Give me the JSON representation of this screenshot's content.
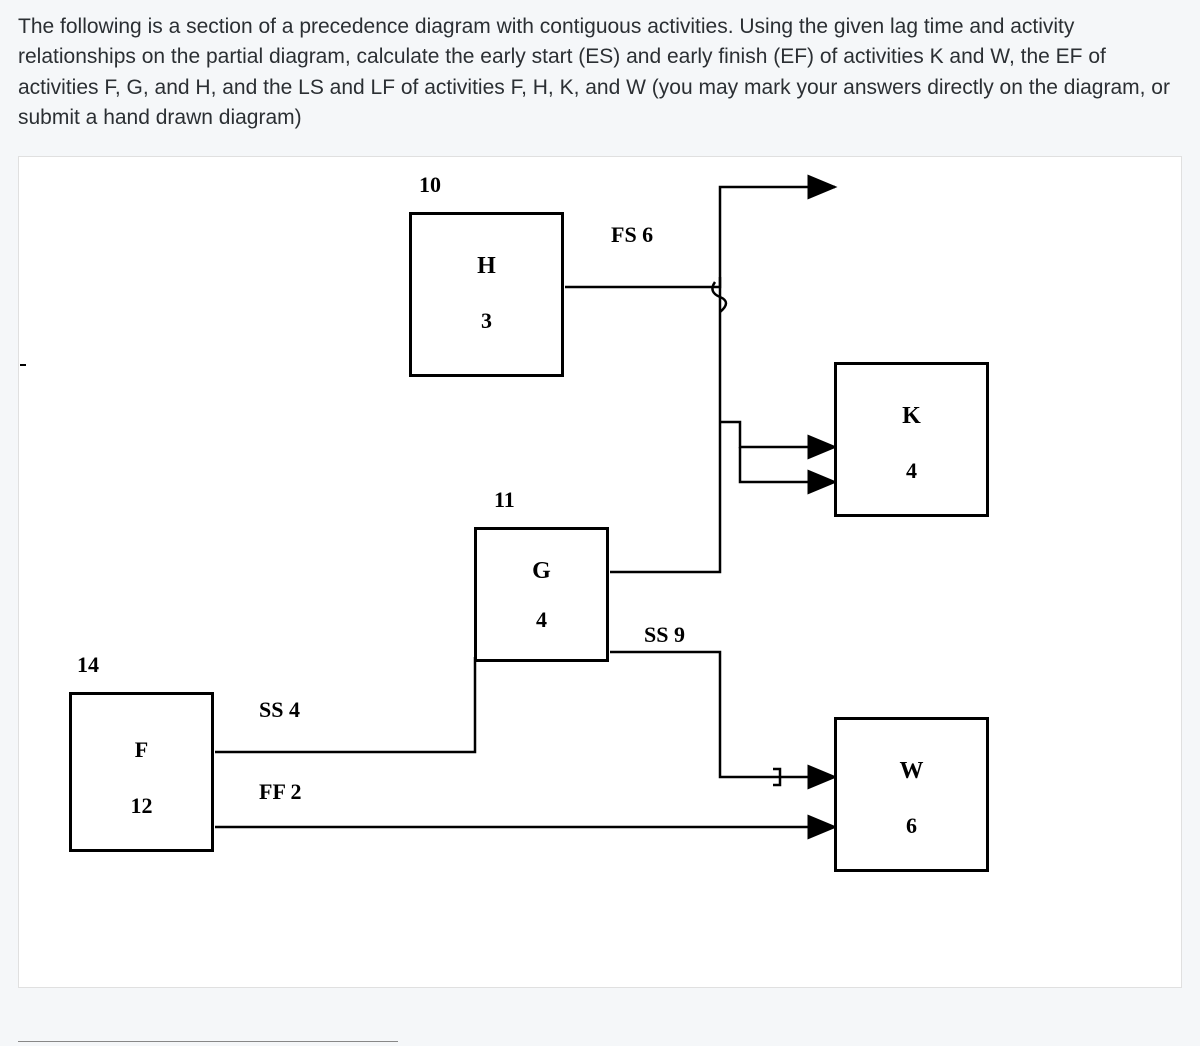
{
  "question": "The following is a section of a precedence diagram with contiguous activities.  Using the given lag time and activity relationships on the partial diagram, calculate the early start (ES) and early finish (EF) of activities K and W, the EF of activities F, G, and H, and the LS and LF of activities F, H, K, and W (you may mark your answers directly on the diagram, or submit a hand drawn diagram)",
  "activities": {
    "H": {
      "name": "H",
      "duration": "3",
      "es": "10"
    },
    "G": {
      "name": "G",
      "duration": "4",
      "es": "11"
    },
    "F": {
      "name": "F",
      "duration": "12",
      "es": "14"
    },
    "K": {
      "name": "K",
      "duration": "4",
      "es": ""
    },
    "W": {
      "name": "W",
      "duration": "6",
      "es": ""
    }
  },
  "relations": {
    "fs6": "FS 6",
    "ss9": "SS 9",
    "ss4": "SS 4",
    "ff2": "FF 2"
  },
  "chart_data": {
    "type": "diagram",
    "nodes": [
      {
        "id": "H",
        "es": 10,
        "duration": 3
      },
      {
        "id": "G",
        "es": 11,
        "duration": 4
      },
      {
        "id": "F",
        "es": 14,
        "duration": 12
      },
      {
        "id": "K",
        "es": null,
        "duration": 4
      },
      {
        "id": "W",
        "es": null,
        "duration": 6
      }
    ],
    "edges": [
      {
        "from": "H",
        "to": "K",
        "type": "FS",
        "lag": 6
      },
      {
        "from": "G",
        "to": "K",
        "type": "FS",
        "lag": 0
      },
      {
        "from": "G",
        "to": "W",
        "type": "SS",
        "lag": 9
      },
      {
        "from": "F",
        "to": "G",
        "type": "SS",
        "lag": 4
      },
      {
        "from": "F",
        "to": "W",
        "type": "FF",
        "lag": 2
      }
    ]
  }
}
